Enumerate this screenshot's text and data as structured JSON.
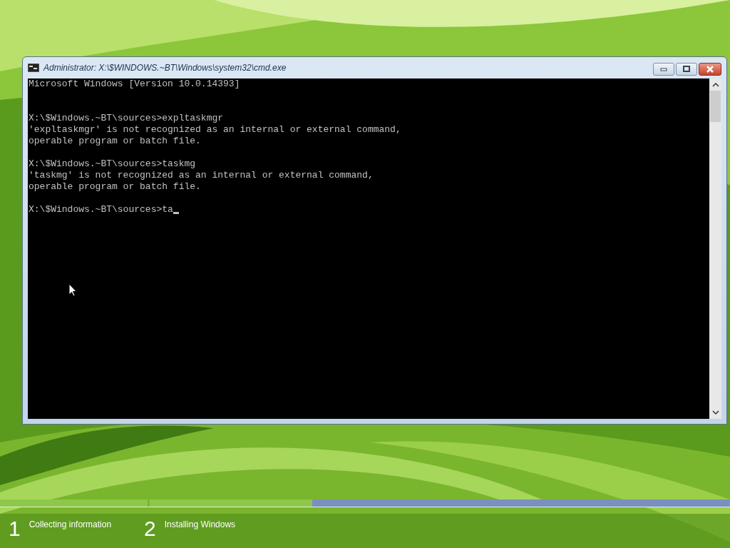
{
  "window": {
    "title": "Administrator: X:\\$WINDOWS.~BT\\Windows\\system32\\cmd.exe"
  },
  "console": {
    "lines": [
      {
        "kind": "banner",
        "text": "Microsoft Windows [Version 10.0.14393]"
      },
      {
        "kind": "prompt",
        "text": "X:\\$Windows.~BT\\sources>expltaskmgr"
      },
      {
        "kind": "output",
        "text": "'expltaskmgr' is not recognized as an internal or external command,"
      },
      {
        "kind": "output",
        "text": "operable program or batch file."
      },
      {
        "kind": "prompt",
        "text": "X:\\$Windows.~BT\\sources>taskmg"
      },
      {
        "kind": "output",
        "text": "'taskmg' is not recognized as an internal or external command,"
      },
      {
        "kind": "output",
        "text": "operable program or batch file."
      },
      {
        "kind": "prompt",
        "text": "X:\\$Windows.~BT\\sources>ta",
        "cursor": true
      }
    ]
  },
  "setup_progress": {
    "steps": [
      {
        "number": "1",
        "label": "Collecting information",
        "level": 1
      },
      {
        "number": "2",
        "label": "Installing Windows",
        "level": 0.28
      }
    ]
  }
}
